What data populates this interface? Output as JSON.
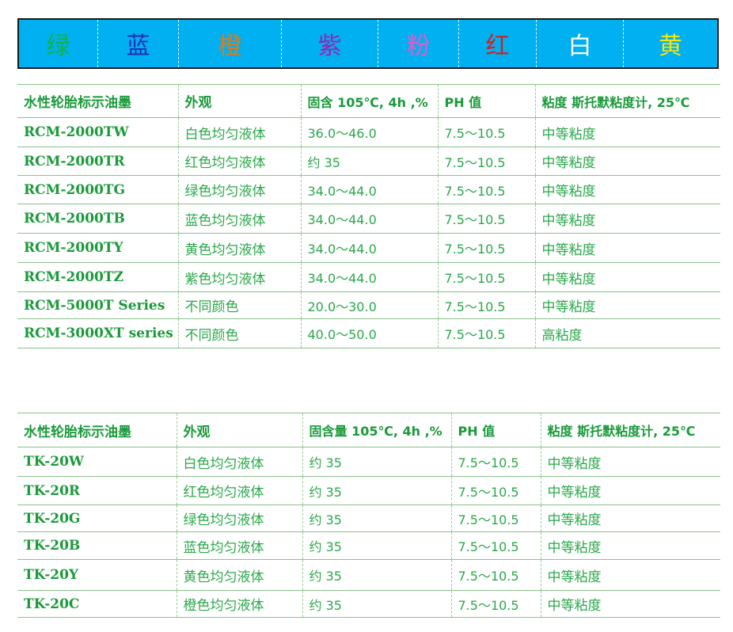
{
  "banner": {
    "colors": [
      {
        "label": "绿",
        "color": "#11b24a"
      },
      {
        "label": "蓝",
        "color": "#1f2db8"
      },
      {
        "label": "橙",
        "color": "#e07a18"
      },
      {
        "label": "紫",
        "color": "#9b22b8"
      },
      {
        "label": "粉",
        "color": "#e65ac8"
      },
      {
        "label": "红",
        "color": "#d81e1e"
      },
      {
        "label": "白",
        "color": "#ffffff"
      },
      {
        "label": "黄",
        "color": "#f0e614"
      }
    ]
  },
  "table1": {
    "headers": [
      "水性轮胎标示油墨",
      "外观",
      "固含 105℃, 4h ,%",
      "PH 值",
      "粘度 斯托默粘度计, 25℃"
    ],
    "rows": [
      [
        "RCM-2000TW",
        "白色均匀液体",
        "36.0～46.0",
        "7.5～10.5",
        "中等粘度"
      ],
      [
        "RCM-2000TR",
        "红色均匀液体",
        "约 35",
        "7.5～10.5",
        "中等粘度"
      ],
      [
        "RCM-2000TG",
        "绿色均匀液体",
        "34.0～44.0",
        "7.5～10.5",
        "中等粘度"
      ],
      [
        "RCM-2000TB",
        "蓝色均匀液体",
        "34.0～44.0",
        "7.5～10.5",
        "中等粘度"
      ],
      [
        "RCM-2000TY",
        "黄色均匀液体",
        "34.0～44.0",
        "7.5～10.5",
        "中等粘度"
      ],
      [
        "RCM-2000TZ",
        "紫色均匀液体",
        "34.0～44.0",
        "7.5～10.5",
        "中等粘度"
      ],
      [
        "RCM-5000T Series",
        "不同颜色",
        "20.0～30.0",
        "7.5～10.5",
        "中等粘度"
      ],
      [
        "RCM-3000XT series",
        "不同颜色",
        "40.0～50.0",
        "7.5～10.5",
        "高粘度"
      ]
    ]
  },
  "table2": {
    "headers": [
      "水性轮胎标示油墨",
      "外观",
      "固含量 105℃, 4h ,%",
      "PH 值",
      "粘度 斯托默粘度计, 25℃"
    ],
    "rows": [
      [
        "TK-20W",
        "白色均匀液体",
        "约 35",
        "7.5～10.5",
        "中等粘度"
      ],
      [
        "TK-20R",
        "红色均匀液体",
        "约 35",
        "7.5～10.5",
        "中等粘度"
      ],
      [
        "TK-20G",
        "绿色均匀液体",
        "约 35",
        "7.5～10.5",
        "中等粘度"
      ],
      [
        "TK-20B",
        "蓝色均匀液体",
        "约 35",
        "7.5～10.5",
        "中等粘度"
      ],
      [
        "TK-20Y",
        "黄色均匀液体",
        "约 35",
        "7.5～10.5",
        "中等粘度"
      ],
      [
        "TK-20C",
        "橙色均匀液体",
        "约 35",
        "7.5～10.5",
        "中等粘度"
      ]
    ]
  }
}
